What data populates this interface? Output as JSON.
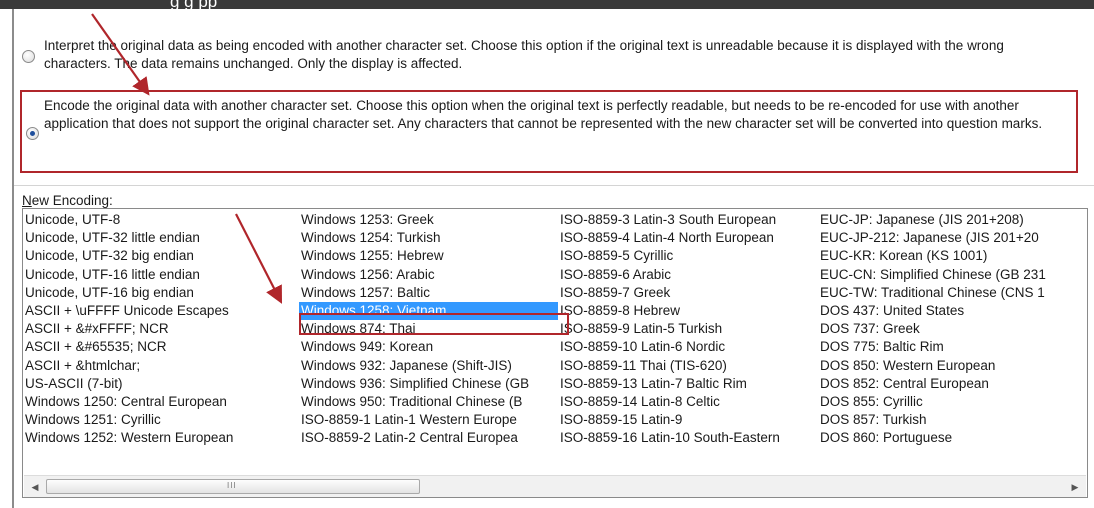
{
  "dialog": {
    "title_partial": "g                                                                                      g     pp"
  },
  "options": {
    "interpret": {
      "label": "Interpret the original data as being encoded with another character set.  Choose this option if the original text is unreadable because it is displayed with the wrong characters.  The data remains unchanged.  Only the display is affected.",
      "checked": false
    },
    "encode": {
      "label": "Encode the original data with another character set.  Choose this option when the original text is perfectly readable, but needs to be re-encoded for use with another application that does not support the original character set.  Any characters that cannot be represented with the new character set will be converted into question marks.",
      "checked": true
    }
  },
  "encoding_list": {
    "label_accel": "N",
    "label_rest": "ew Encoding:",
    "selected": "Windows 1258: Vietnam",
    "columns": [
      [
        "Unicode, UTF-8",
        "Unicode, UTF-32 little endian",
        "Unicode, UTF-32 big endian",
        "Unicode, UTF-16 little endian",
        "Unicode, UTF-16 big endian",
        "ASCII + \\uFFFF Unicode Escapes",
        "ASCII + &#xFFFF; NCR",
        "ASCII + &#65535; NCR",
        "ASCII + &htmlchar;",
        "US-ASCII (7-bit)",
        "Windows 1250: Central European",
        "Windows 1251: Cyrillic",
        "Windows 1252: Western European"
      ],
      [
        "Windows 1253: Greek",
        "Windows 1254: Turkish",
        "Windows 1255: Hebrew",
        "Windows 1256: Arabic",
        "Windows 1257: Baltic",
        "Windows 1258: Vietnam",
        "Windows 874: Thai",
        "Windows 949: Korean",
        "Windows 932: Japanese (Shift-JIS)",
        "Windows 936: Simplified Chinese (GB",
        "Windows 950: Traditional Chinese (B",
        "ISO-8859-1 Latin-1 Western Europe",
        "ISO-8859-2 Latin-2 Central Europea"
      ],
      [
        "ISO-8859-3 Latin-3 South European",
        "ISO-8859-4 Latin-4 North European",
        "ISO-8859-5 Cyrillic",
        "ISO-8859-6 Arabic",
        "ISO-8859-7 Greek",
        "ISO-8859-8 Hebrew",
        "ISO-8859-9 Latin-5 Turkish",
        "ISO-8859-10 Latin-6 Nordic",
        "ISO-8859-11 Thai (TIS-620)",
        "ISO-8859-13 Latin-7 Baltic Rim",
        "ISO-8859-14 Latin-8 Celtic",
        "ISO-8859-15 Latin-9",
        "ISO-8859-16 Latin-10 South-Eastern"
      ],
      [
        "EUC-JP: Japanese (JIS 201+208)",
        "EUC-JP-212: Japanese (JIS 201+20",
        "EUC-KR: Korean (KS 1001)",
        "EUC-CN: Simplified Chinese (GB 231",
        "EUC-TW: Traditional Chinese (CNS 1",
        "DOS 437: United States",
        "DOS 737: Greek",
        "DOS 775: Baltic Rim",
        "DOS 850: Western European",
        "DOS 852: Central European",
        "DOS 855: Cyrillic",
        "DOS 857: Turkish",
        "DOS 860: Portuguese"
      ]
    ]
  },
  "scrollbar": {
    "left_arrow": "◀",
    "right_arrow": "▶",
    "grip": "III"
  },
  "colors": {
    "highlight_box": "#b0262b",
    "selection": "#3399ff",
    "radio_checked": "#1f4f9c"
  }
}
